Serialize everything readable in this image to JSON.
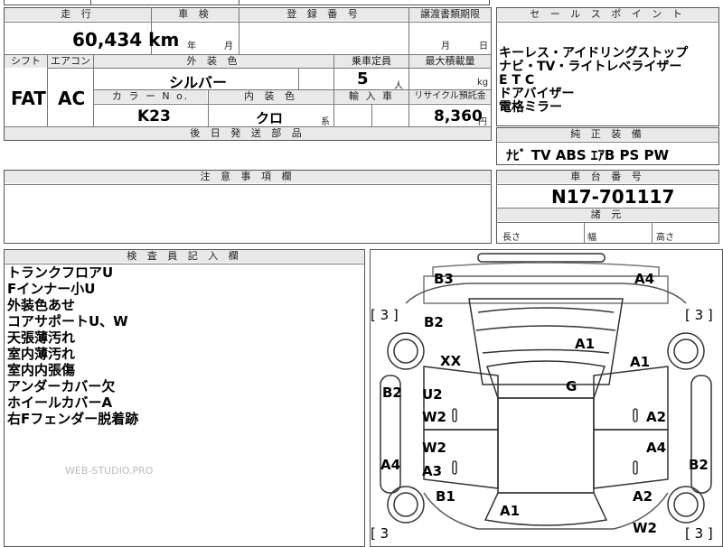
{
  "top": {
    "mileage_header": "走 行",
    "mileage_value": "60,434 km",
    "inspection_header": "車 検",
    "inspection_year": "年",
    "inspection_month": "月",
    "registration_header": "登 録 番 号",
    "transfer_header": "譲渡書類期限",
    "transfer_month": "月",
    "transfer_day": "日",
    "selling_points_header": "セ ー ル ス ポ イ ン ト",
    "selling_points": [
      "キーレス・アイドリングストップ",
      "ナビ・TV・ライトレベライザー",
      "E T C",
      "ドアバイザー",
      "電格ミラー"
    ]
  },
  "spec": {
    "shift_header": "シフト",
    "shift": "FAT",
    "aircon_header": "エアコン",
    "aircon": "AC",
    "exterior_color_header": "外 装 色",
    "exterior_color": "シルバー",
    "capacity_header": "乗車定員",
    "capacity": "5",
    "capacity_unit": "人",
    "max_load_header": "最大積載量",
    "max_load_unit": "kg",
    "color_no_header": "カ ラ ー N o.",
    "color_no": "K23",
    "interior_color_header": "内 装 色",
    "interior_color": "クロ",
    "interior_suffix": "系",
    "import_header": "輸 入 車",
    "recycle_header": "リサイクル預託金",
    "recycle_value": "8,360",
    "recycle_unit": "円",
    "later_parts_header": "後 日 発 送 部 品"
  },
  "equipment": {
    "header": "純 正 装 備",
    "items": "ﾅﾋﾞ TV ABS ｴｱB PS PW"
  },
  "notes_header": "注 意 事 項 欄",
  "chassis": {
    "header": "車 台 番 号",
    "number": "N17-701117",
    "dims_header": "諸 元",
    "length": "長さ",
    "width": "幅",
    "height": "高さ"
  },
  "inspector": {
    "header": "検 査 員 記 入 欄",
    "lines": [
      "トランクフロアU",
      "Fインナー小U",
      "外装色あせ",
      "コアサポートU、W",
      "天張薄汚れ",
      "室内薄汚れ",
      "室内内張傷",
      "アンダーカバー欠",
      "ホイールカバーA",
      "右Fフェンダー脱着跡"
    ],
    "watermark": "WEB-STUDIO.PRO"
  },
  "diagram": {
    "marks": {
      "b3": "B3",
      "a4_top": "A4",
      "tire_tl": "[ 3 ]",
      "tire_tr": "[ 3 ]",
      "b2_top": "B2",
      "a1_roof": "A1",
      "xx": "XX",
      "a1_right": "A1",
      "b2_left": "B2",
      "u2": "U2",
      "g": "G",
      "w2_left1": "W2",
      "a2_right1": "A2",
      "w2_left2": "W2",
      "a4_right": "A4",
      "a4_left": "A4",
      "a3": "A3",
      "b2_right": "B2",
      "b1": "B1",
      "a2_right2": "A2",
      "a1_bottom": "A1",
      "w2_bottom": "W2",
      "tire_bl": "[ 3",
      "tire_br": "[ 3 ]"
    }
  }
}
